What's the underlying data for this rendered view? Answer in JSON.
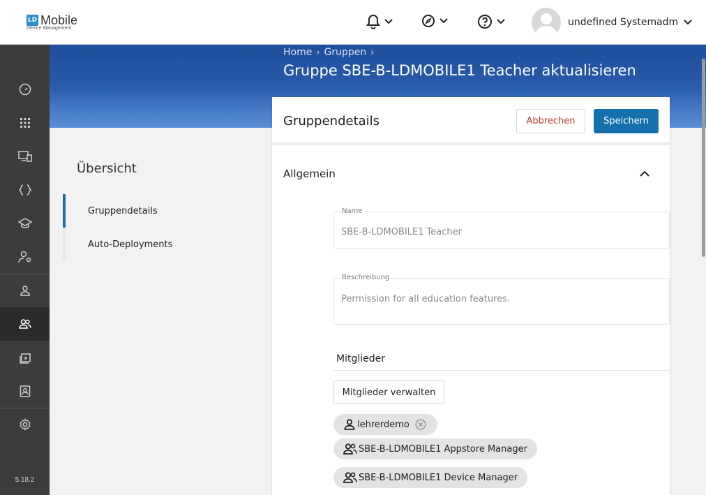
{
  "header": {
    "logo_title": "Mobile",
    "logo_sub": "Device Management",
    "logo_mark": "LD",
    "user_name": "undefined Systemadmi..."
  },
  "sidenav": {
    "version": "5.18.2"
  },
  "breadcrumb": [
    "Home",
    "Gruppen"
  ],
  "page_title": "Gruppe SBE-B-LDMOBILE1 Teacher aktualisieren",
  "overview": {
    "title": "Übersicht",
    "items": [
      "Gruppendetails",
      "Auto-Deployments"
    ]
  },
  "card": {
    "title": "Gruppendetails",
    "cancel_label": "Abbrechen",
    "save_label": "Speichern",
    "section_title": "Allgemein",
    "name_label": "Name",
    "name_value": "SBE-B-LDMOBILE1 Teacher",
    "description_label": "Beschreibung",
    "description_value": "Permission for all education features.",
    "members_title": "Mitglieder",
    "manage_members_label": "Mitglieder verwalten",
    "members": [
      {
        "type": "user",
        "label": "lehrerdemo",
        "removable": true
      },
      {
        "type": "group",
        "label": "SBE-B-LDMOBILE1 Appstore Manager",
        "removable": false
      },
      {
        "type": "group",
        "label": "SBE-B-LDMOBILE1 Device Manager",
        "removable": false
      }
    ]
  },
  "colors": {
    "primary": "#1470ab",
    "danger": "#c0392b",
    "nav_bg": "#3c3c3c",
    "hero": "#1f4e9a"
  }
}
